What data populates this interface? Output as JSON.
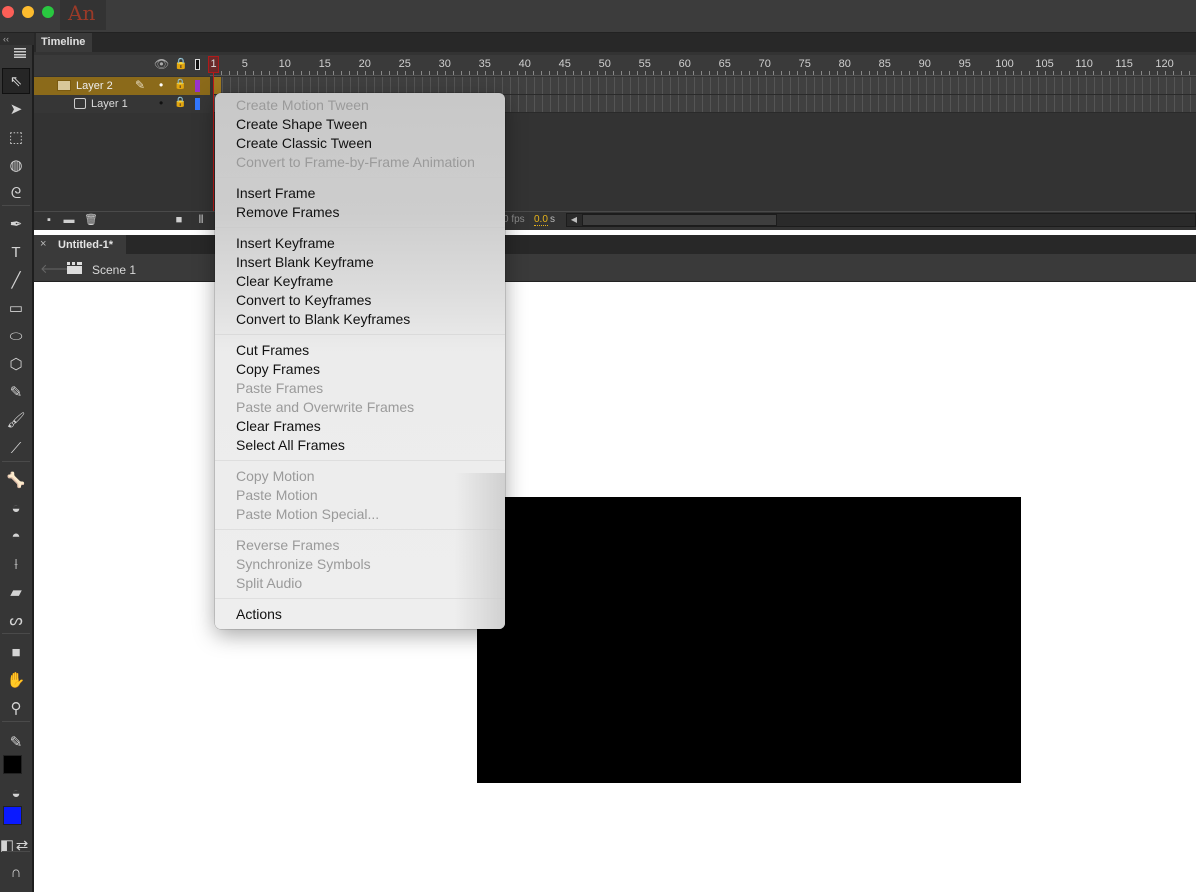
{
  "app": {
    "badge": "An",
    "traffic_lights": {
      "close": "#fc5f57",
      "minimize": "#fdbc2e",
      "maximize": "#29c840"
    }
  },
  "toolbar": {
    "collapse_glyph": "‹‹",
    "tools": [
      {
        "name": "selection-tool-icon",
        "glyph": "⇖",
        "active": true
      },
      {
        "name": "subselection-tool-icon",
        "glyph": "➤"
      },
      {
        "name": "free-transform-tool-icon",
        "glyph": "⬚"
      },
      {
        "name": "3d-rotation-tool-icon",
        "glyph": "◍"
      },
      {
        "name": "lasso-tool-icon",
        "glyph": "ᘓ"
      },
      {
        "name": "pen-tool-icon",
        "glyph": "✒"
      },
      {
        "name": "text-tool-icon",
        "glyph": "T"
      },
      {
        "name": "line-tool-icon",
        "glyph": "╱"
      },
      {
        "name": "rectangle-tool-icon",
        "glyph": "▭"
      },
      {
        "name": "oval-tool-icon",
        "glyph": "⬭"
      },
      {
        "name": "polystar-tool-icon",
        "glyph": "⬡"
      },
      {
        "name": "pencil-tool-icon",
        "glyph": "✎"
      },
      {
        "name": "paint-brush-tool-icon",
        "glyph": "🖌"
      },
      {
        "name": "brush-tool-icon",
        "glyph": "⟋"
      },
      {
        "name": "bone-tool-icon",
        "glyph": "🦴"
      },
      {
        "name": "paint-bucket-tool-icon",
        "glyph": "◒"
      },
      {
        "name": "ink-bottle-tool-icon",
        "glyph": "◓"
      },
      {
        "name": "eyedropper-tool-icon",
        "glyph": "⟊"
      },
      {
        "name": "eraser-tool-icon",
        "glyph": "▰"
      },
      {
        "name": "width-tool-icon",
        "glyph": "ᔕ"
      },
      {
        "name": "camera-tool-icon",
        "glyph": "■"
      },
      {
        "name": "hand-tool-icon",
        "glyph": "✋"
      },
      {
        "name": "zoom-tool-icon",
        "glyph": "⚲"
      },
      {
        "name": "stroke-color-pencil-icon",
        "glyph": "✎"
      },
      {
        "name": "fill-bucket-icon",
        "glyph": "◒"
      },
      {
        "name": "black-white-icon",
        "glyph": "◧"
      },
      {
        "name": "swap-colors-icon",
        "glyph": "⇄"
      },
      {
        "name": "snap-magnet-icon",
        "glyph": "∩"
      }
    ],
    "stroke_color": "#000000",
    "fill_color": "#0a1aff"
  },
  "timeline": {
    "tab_label": "Timeline",
    "current_frame": "1",
    "ruler_labels": [
      "5",
      "10",
      "15",
      "20",
      "25",
      "30",
      "35",
      "40",
      "45",
      "50",
      "55",
      "60",
      "65",
      "70",
      "75",
      "80",
      "85",
      "90",
      "95",
      "100",
      "105",
      "110",
      "115",
      "120"
    ],
    "layers": [
      {
        "name": "Layer 2",
        "selected": true,
        "color": "#9933cc",
        "visible_dot": "•",
        "lock": "🔒"
      },
      {
        "name": "Layer 1",
        "selected": false,
        "color": "#3377ff",
        "visible_dot": "•",
        "lock": "🔒"
      }
    ],
    "fps_text": "0 fps",
    "time_value": "0.0",
    "time_unit": "s"
  },
  "document": {
    "tab_title": "Untitled-1*",
    "close_glyph": "×",
    "scene_label": "Scene 1",
    "back_glyph": "🡐"
  },
  "stage": {
    "background": "#ffffff",
    "shape_fill": "#000000"
  },
  "context_menu": {
    "groups": [
      [
        {
          "label": "Create Motion Tween",
          "enabled": false
        },
        {
          "label": "Create Shape Tween",
          "enabled": true
        },
        {
          "label": "Create Classic Tween",
          "enabled": true
        },
        {
          "label": "Convert to Frame-by-Frame Animation",
          "enabled": false
        }
      ],
      [
        {
          "label": "Insert Frame",
          "enabled": true
        },
        {
          "label": "Remove Frames",
          "enabled": true
        }
      ],
      [
        {
          "label": "Insert Keyframe",
          "enabled": true
        },
        {
          "label": "Insert Blank Keyframe",
          "enabled": true
        },
        {
          "label": "Clear Keyframe",
          "enabled": true
        },
        {
          "label": "Convert to Keyframes",
          "enabled": true
        },
        {
          "label": "Convert to Blank Keyframes",
          "enabled": true
        }
      ],
      [
        {
          "label": "Cut Frames",
          "enabled": true
        },
        {
          "label": "Copy Frames",
          "enabled": true
        },
        {
          "label": "Paste Frames",
          "enabled": false
        },
        {
          "label": "Paste and Overwrite Frames",
          "enabled": false
        },
        {
          "label": "Clear Frames",
          "enabled": true
        },
        {
          "label": "Select All Frames",
          "enabled": true
        }
      ],
      [
        {
          "label": "Copy Motion",
          "enabled": false
        },
        {
          "label": "Paste Motion",
          "enabled": false
        },
        {
          "label": "Paste Motion Special...",
          "enabled": false
        }
      ],
      [
        {
          "label": "Reverse Frames",
          "enabled": false
        },
        {
          "label": "Synchronize Symbols",
          "enabled": false
        },
        {
          "label": "Split Audio",
          "enabled": false
        }
      ],
      [
        {
          "label": "Actions",
          "enabled": true
        }
      ]
    ]
  }
}
